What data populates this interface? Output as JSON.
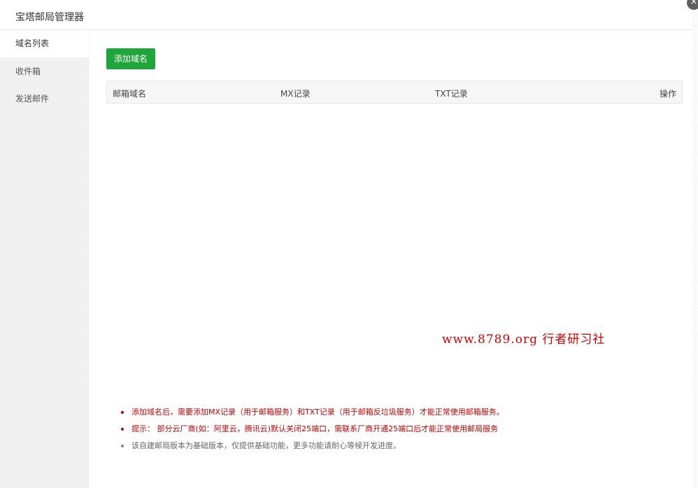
{
  "modal": {
    "title": "宝塔邮局管理器",
    "close_symbol": "×"
  },
  "sidebar": {
    "items": [
      {
        "label": "域名列表",
        "active": true
      },
      {
        "label": "收件箱",
        "active": false
      },
      {
        "label": "发送邮件",
        "active": false
      }
    ]
  },
  "toolbar": {
    "add_domain_label": "添加域名"
  },
  "table": {
    "headers": [
      "邮箱域名",
      "MX记录",
      "TXT记录",
      "操作"
    ]
  },
  "notes": [
    "添加域名后，需要添加MX记录（用于邮箱服务）和TXT记录（用于邮箱反垃圾服务）才能正常使用邮箱服务。",
    "提示： 部分云厂商(如：阿里云，腾讯云)默认关闭25端口，需联系厂商开通25端口后才能正常使用邮局服务",
    "该自建邮局版本为基础版本，仅提供基础功能，更多功能请耐心等候开发进度。"
  ],
  "watermark": {
    "text": "www.8789.org 行者研习社"
  }
}
